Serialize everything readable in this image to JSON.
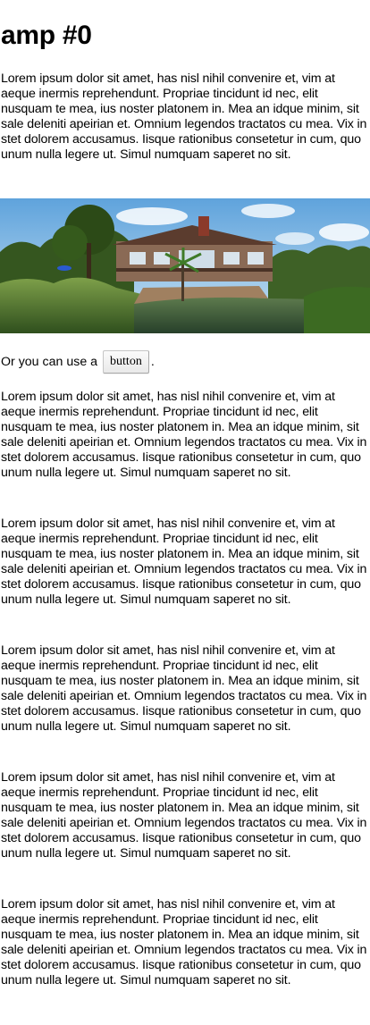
{
  "page": {
    "title": "amp #0"
  },
  "paragraphs": {
    "p0": "Lorem ipsum dolor sit amet, has nisl nihil convenire et, vim at aeque inermis reprehendunt. Propriae tincidunt id nec, elit nusquam te mea, ius noster platonem in. Mea an idque minim, sit sale deleniti apeirian et. Omnium legendos tractatos cu mea. Vix in stet dolorem accusamus. Iisque rationibus consetetur in cum, quo unum nulla legere ut. Simul numquam saperet no sit.",
    "p1": "Lorem ipsum dolor sit amet, has nisl nihil convenire et, vim at aeque inermis reprehendunt. Propriae tincidunt id nec, elit nusquam te mea, ius noster platonem in. Mea an idque minim, sit sale deleniti apeirian et. Omnium legendos tractatos cu mea. Vix in stet dolorem accusamus. Iisque rationibus consetetur in cum, quo unum nulla legere ut. Simul numquam saperet no sit.",
    "p2": "Lorem ipsum dolor sit amet, has nisl nihil convenire et, vim at aeque inermis reprehendunt. Propriae tincidunt id nec, elit nusquam te mea, ius noster platonem in. Mea an idque minim, sit sale deleniti apeirian et. Omnium legendos tractatos cu mea. Vix in stet dolorem accusamus. Iisque rationibus consetetur in cum, quo unum nulla legere ut. Simul numquam saperet no sit.",
    "p3": "Lorem ipsum dolor sit amet, has nisl nihil convenire et, vim at aeque inermis reprehendunt. Propriae tincidunt id nec, elit nusquam te mea, ius noster platonem in. Mea an idque minim, sit sale deleniti apeirian et. Omnium legendos tractatos cu mea. Vix in stet dolorem accusamus. Iisque rationibus consetetur in cum, quo unum nulla legere ut. Simul numquam saperet no sit.",
    "p4": "Lorem ipsum dolor sit amet, has nisl nihil convenire et, vim at aeque inermis reprehendunt. Propriae tincidunt id nec, elit nusquam te mea, ius noster platonem in. Mea an idque minim, sit sale deleniti apeirian et. Omnium legendos tractatos cu mea. Vix in stet dolorem accusamus. Iisque rationibus consetetur in cum, quo unum nulla legere ut. Simul numquam saperet no sit.",
    "p5": "Lorem ipsum dolor sit amet, has nisl nihil convenire et, vim at aeque inermis reprehendunt. Propriae tincidunt id nec, elit nusquam te mea, ius noster platonem in. Mea an idque minim, sit sale deleniti apeirian et. Omnium legendos tractatos cu mea. Vix in stet dolorem accusamus. Iisque rationibus consetetur in cum, quo unum nulla legere ut. Simul numquam saperet no sit."
  },
  "cta": {
    "prefix": "Or you can use a",
    "button_label": "button",
    "suffix": "."
  },
  "hero": {
    "icon": "house-photo",
    "colors": {
      "sky": "#7fb8e6",
      "foliage": "#4f7a2e",
      "water": "#3d5a3a",
      "roof": "#6b4a3a"
    }
  }
}
